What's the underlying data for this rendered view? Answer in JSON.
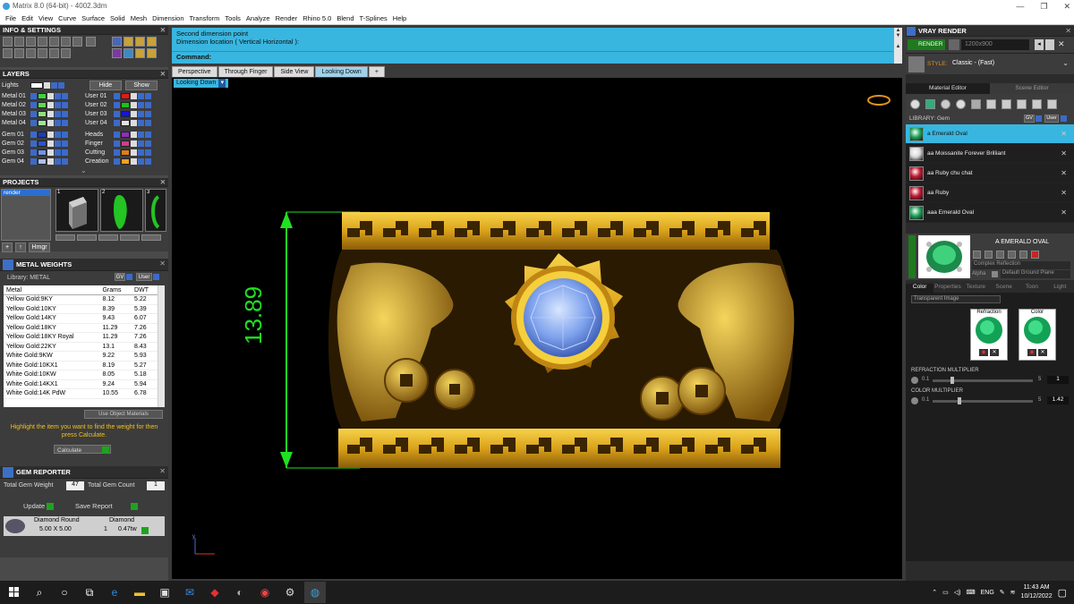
{
  "window": {
    "title": "Matrix 8.0 (64-bit) - 4002.3dm",
    "controls": [
      "—",
      "❐",
      "✕"
    ]
  },
  "menu": [
    "File",
    "Edit",
    "View",
    "Curve",
    "Surface",
    "Solid",
    "Mesh",
    "Dimension",
    "Transform",
    "Tools",
    "Analyze",
    "Render",
    "Rhino 5.0",
    "Blend",
    "T-Splines",
    "Help"
  ],
  "info_settings": {
    "title": "INFO & SETTINGS"
  },
  "layers": {
    "title": "LAYERS",
    "lights": "Lights",
    "hide": "Hide",
    "show": "Show",
    "left": [
      {
        "name": "Metal 01",
        "color": "#3ed13e"
      },
      {
        "name": "Metal 02",
        "color": "#5fd84f"
      },
      {
        "name": "Metal 03",
        "color": "#8ee07a"
      },
      {
        "name": "Metal 04",
        "color": "#9fe597"
      },
      {
        "name": "Gem 01",
        "color": "#1b3fb3"
      },
      {
        "name": "Gem 02",
        "color": "#2856d0"
      },
      {
        "name": "Gem 03",
        "color": "#6f94e6"
      },
      {
        "name": "Gem 04",
        "color": "#a9c0f0"
      }
    ],
    "right": [
      {
        "name": "User 01",
        "color": "#e01a1a"
      },
      {
        "name": "User 02",
        "color": "#19c219"
      },
      {
        "name": "User 03",
        "color": "#1515d9"
      },
      {
        "name": "User 04",
        "color": "#e3e3e3"
      },
      {
        "name": "Heads",
        "color": "#8c2eb8"
      },
      {
        "name": "Finger",
        "color": "#d13c8c"
      },
      {
        "name": "Cutting",
        "color": "#e07d1a"
      },
      {
        "name": "Creation",
        "color": "#f0a020"
      }
    ]
  },
  "projects": {
    "title": "PROJECTS",
    "item": "render",
    "thumbs": [
      "1",
      "2",
      "3"
    ],
    "hmgr": "Hmgr"
  },
  "metal_weights": {
    "title": "METAL WEIGHTS",
    "library": "Library: METAL",
    "gv": "GV",
    "user": "User",
    "headers": [
      "Metal",
      "Grams",
      "DWT"
    ],
    "rows": [
      [
        "Yellow Gold:9KY",
        "8.12",
        "5.22"
      ],
      [
        "Yellow Gold:10KY",
        "8.39",
        "5.39"
      ],
      [
        "Yellow Gold:14KY",
        "9.43",
        "6.07"
      ],
      [
        "Yellow Gold:18KY",
        "11.29",
        "7.26"
      ],
      [
        "Yellow Gold:18KY Royal",
        "11.29",
        "7.26"
      ],
      [
        "Yellow Gold:22KY",
        "13.1",
        "8.43"
      ],
      [
        "White Gold:9KW",
        "9.22",
        "5.93"
      ],
      [
        "White Gold:10KX1",
        "8.19",
        "5.27"
      ],
      [
        "White Gold:10KW",
        "8.05",
        "5.18"
      ],
      [
        "White Gold:14KX1",
        "9.24",
        "5.94"
      ],
      [
        "White Gold:14K PdW",
        "10.55",
        "6.78"
      ]
    ],
    "use_object": "Use Object Materials",
    "hint": "Highlight the item you want to find the weight for then press Calculate.",
    "calculate": "Calculate"
  },
  "gem_reporter": {
    "title": "GEM REPORTER",
    "total_weight_label": "Total Gem Weight",
    "total_weight": "47",
    "total_count_label": "Total Gem Count",
    "total_count": "1",
    "update": "Update",
    "save_report": "Save Report",
    "gem_cut": "Diamond Round",
    "gem_type": "Diamond",
    "size": "5.00 X 5.00",
    "qty": "1",
    "ctw": "0.47tw"
  },
  "command": {
    "line1": "Second dimension point",
    "line2": "Dimension location ( Vertical  Horizontal ):",
    "prompt": "Command:"
  },
  "view_tabs": [
    "Perspective",
    "Through Finger",
    "Side View",
    "Looking Down",
    "+"
  ],
  "active_view": "Looking Down",
  "viewport": {
    "dimension": "13.89",
    "axis": "y"
  },
  "vray": {
    "title": "VRAY RENDER",
    "render": "RENDER",
    "resolution": "1200x900",
    "style_label": "STYLE:",
    "style": "Classic - (Fast)",
    "tab_material": "Material Editor",
    "tab_scene": "Scene Editor",
    "library": "LIBRARY: Gem",
    "gv": "GV",
    "user": "User",
    "materials": [
      {
        "name": "a Emerald Oval",
        "color": "#1fa35a",
        "selected": true
      },
      {
        "name": "aa Moissanite Forever Brilliant",
        "color": "#d8d8d8",
        "selected": false
      },
      {
        "name": "aa Ruby chu chat",
        "color": "#c21b32",
        "selected": false
      },
      {
        "name": "aa Ruby",
        "color": "#c21b32",
        "selected": false
      },
      {
        "name": "aaa Emerald Oval",
        "color": "#1fa35a",
        "selected": false
      }
    ],
    "preview_name": "A EMERALD OVAL",
    "complex": "Complex Reflection",
    "alpha": "Alpha",
    "ground": "Default Ground Plane",
    "subtabs": [
      "Color",
      "Properties",
      "Texture",
      "Scene",
      "Toon",
      "Light"
    ],
    "transparent": "Transparent Image",
    "refraction": "Refraction",
    "color": "Color",
    "refraction_mult_label": "REFRACTION MULTIPLIER",
    "refraction_mult": "1",
    "refraction_min": "0.1",
    "refraction_max": "5",
    "color_mult_label": "COLOR MULTIPLIER",
    "color_mult": "1.42",
    "color_min": "0.1",
    "color_max": "5"
  },
  "taskbar": {
    "time": "11:43 AM",
    "date": "10/12/2022",
    "lang": "ENG"
  }
}
